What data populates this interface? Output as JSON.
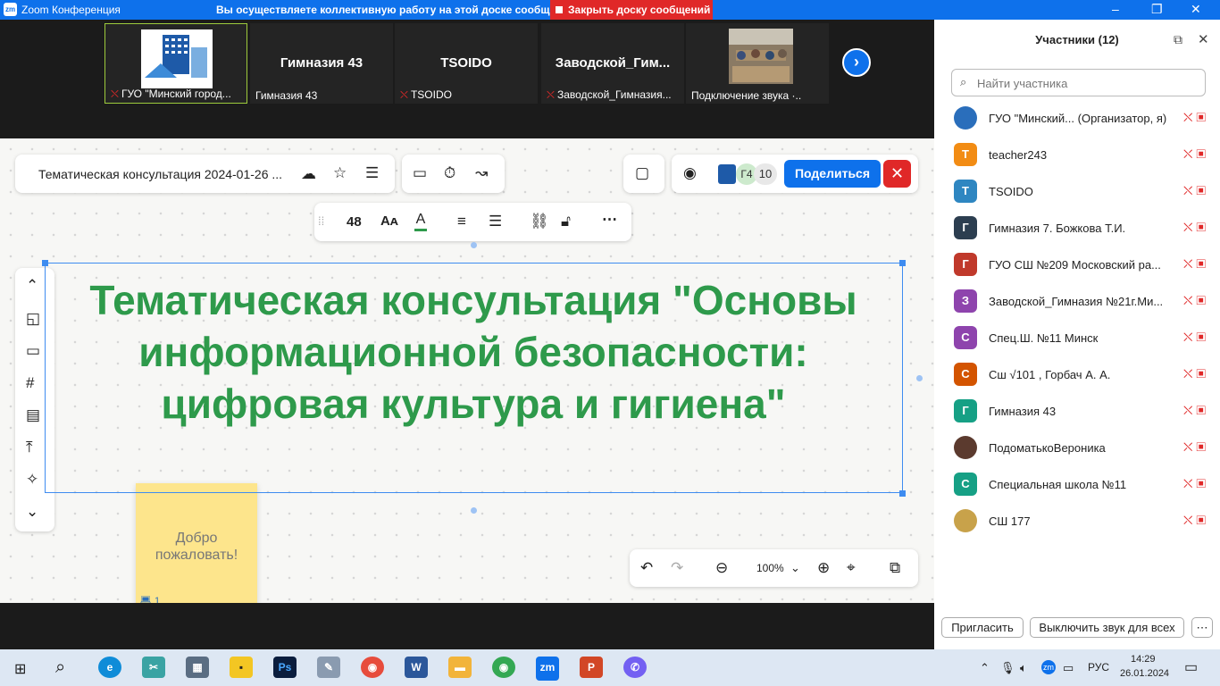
{
  "titlebar": {
    "app_title": "Zoom Конференция",
    "banner": "Вы осуществляете коллективную работу на этой доске сообщений",
    "close_board": "Закрыть доску сообщений"
  },
  "strip": {
    "thumbs": [
      {
        "label": "ГУО \"Минский город...",
        "big": ""
      },
      {
        "label": "Гимназия 43",
        "big": "Гимназия 43"
      },
      {
        "label": "TSOIDO",
        "big": "TSOIDO"
      },
      {
        "label": "Заводской_Гимназия...",
        "big": "Заводской_Гим..."
      },
      {
        "label": "Подключение звука ·..",
        "big": ""
      }
    ]
  },
  "board": {
    "doc_title": "Тематическая консультация 2024-01-26 ...",
    "share_label": "Поделиться",
    "participant_badge": "Г4",
    "participant_count": "10",
    "font_size": "48",
    "headline": "Тематическая консультация \"Основы информационной безопасности: цифровая культура и гигиена\"",
    "sticky_text": "Добро пожаловать!",
    "sticky_count": "1",
    "zoom_level": "100%"
  },
  "sidebar": {
    "title": "Участники (12)",
    "search_placeholder": "Найти участника",
    "participants": [
      {
        "name": "ГУО \"Минский... (Организатор, я)",
        "initial": "",
        "color": "#2a6ebb"
      },
      {
        "name": "teacher243",
        "initial": "T",
        "color": "#f28c14"
      },
      {
        "name": "TSOIDO",
        "initial": "T",
        "color": "#2e86c1"
      },
      {
        "name": "Гимназия 7. Божкова Т.И.",
        "initial": "Г",
        "color": "#2c3e50"
      },
      {
        "name": "ГУО СШ №209 Московский ра...",
        "initial": "Г",
        "color": "#c0392b"
      },
      {
        "name": "Заводской_Гимназия №21г.Ми...",
        "initial": "З",
        "color": "#8e44ad"
      },
      {
        "name": "Спец.Ш. №11 Минск",
        "initial": "С",
        "color": "#8e44ad"
      },
      {
        "name": "Сш √101 , Горбач А. А.",
        "initial": "С",
        "color": "#d35400"
      },
      {
        "name": "Гимназия 43",
        "initial": "Г",
        "color": "#16a085"
      },
      {
        "name": "ПодоматькоВероника",
        "initial": "",
        "color": "#5b3a2e"
      },
      {
        "name": "Специальная школа №11",
        "initial": "С",
        "color": "#16a085"
      },
      {
        "name": "СШ 177",
        "initial": "",
        "color": "#c8a24a"
      }
    ],
    "invite": "Пригласить",
    "mute_all": "Выключить звук для всех"
  },
  "taskbar": {
    "lang": "РУС",
    "time": "14:29",
    "date": "26.01.2024"
  }
}
